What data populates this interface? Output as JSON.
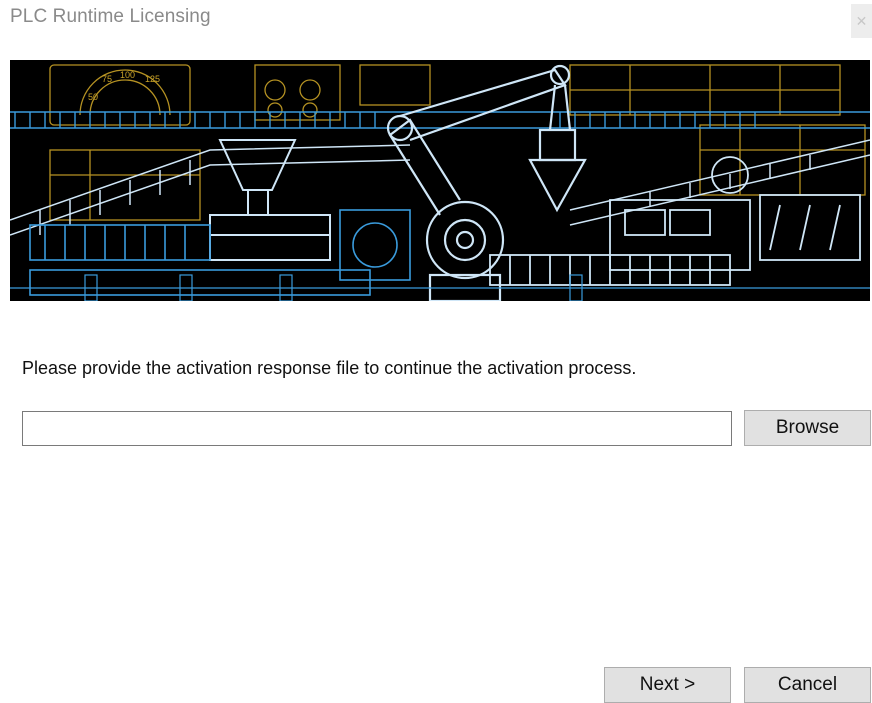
{
  "window": {
    "title": "PLC Runtime Licensing",
    "close_label": "✕"
  },
  "banner": {
    "gauge_labels": [
      "50",
      "75",
      "100",
      "125"
    ],
    "colors": {
      "background": "#000000",
      "line_blue": "#3a9bdc",
      "line_light": "#cfe6f7",
      "line_gold": "#c9a227"
    }
  },
  "content": {
    "instruction": "Please provide the activation response file to continue the activation process.",
    "file_path": {
      "value": "",
      "placeholder": ""
    },
    "browse_label": "Browse"
  },
  "footer": {
    "next_label": "Next >",
    "cancel_label": "Cancel"
  }
}
